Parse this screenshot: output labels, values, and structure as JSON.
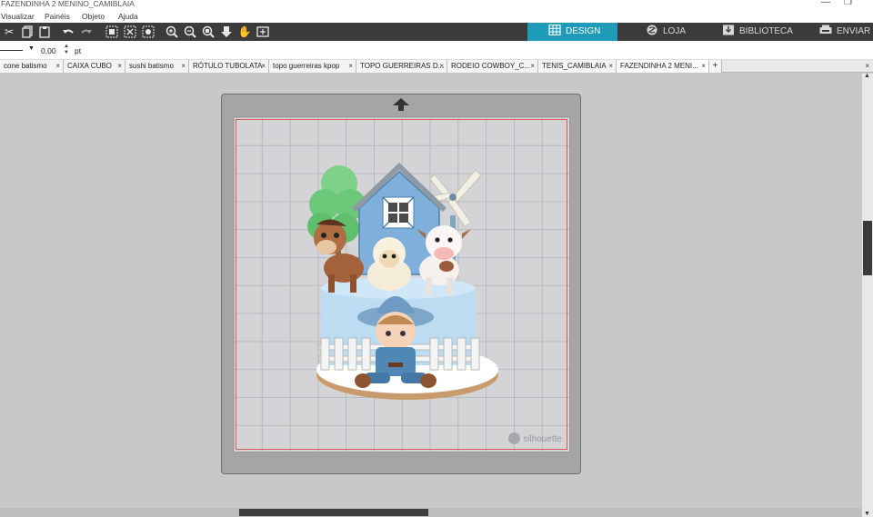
{
  "window": {
    "title": "FAZENDINHA 2 MENINO_CAMIBLAIA"
  },
  "menu": {
    "items": [
      "Visualizar",
      "Painéis",
      "Objeto",
      "Ajuda"
    ]
  },
  "toolbar": {
    "tools": [
      "cut-icon",
      "copy-icon",
      "paste-icon",
      "undo-icon",
      "redo-icon",
      "group-icon",
      "ungroup-icon",
      "image-settings-icon",
      "zoom-in-icon",
      "zoom-out-icon",
      "zoom-selection-icon",
      "move-down-icon",
      "pan-icon",
      "fit-page-icon"
    ],
    "tabs": [
      {
        "label": "DESIGN",
        "icon": "grid-icon",
        "active": true
      },
      {
        "label": "LOJA",
        "icon": "store-icon",
        "active": false
      },
      {
        "label": "BIBLIOTECA",
        "icon": "library-icon",
        "active": false
      },
      {
        "label": "ENVIAR",
        "icon": "send-icon",
        "active": false
      }
    ]
  },
  "properties": {
    "line_width_value": "0,00",
    "unit": "pt"
  },
  "doc_tabs": [
    {
      "label": "cone batismo"
    },
    {
      "label": "CAIXA CUBO"
    },
    {
      "label": "sushi batismo"
    },
    {
      "label": "RÓTULO TUBOLATA"
    },
    {
      "label": "topo guerreiras kpop"
    },
    {
      "label": "TOPO GUERREIRAS D..."
    },
    {
      "label": "RODEIO COWBOY_C..."
    },
    {
      "label": "TENIS_CAMIBLAIA"
    },
    {
      "label": "FAZENDINHA 2 MENI..."
    }
  ],
  "canvas": {
    "watermark": "silhouette",
    "colors": {
      "mat": "#a5a5a5",
      "grid": "#d4d4d6",
      "cut_border": "#e05a5a",
      "accent": "#1e9bb8"
    }
  }
}
